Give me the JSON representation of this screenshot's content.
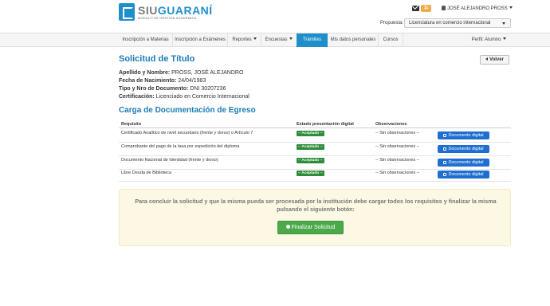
{
  "header": {
    "logo_main": "SIU",
    "logo_accent": "GUARANÍ",
    "logo_sub": "MÓDULO DE GESTIÓN ACADÉMICA",
    "messages_count": "11",
    "user_name": "JOSÉ ALEJANDRO PROSS",
    "propuesta_label": "Propuesta:",
    "propuesta_value": "Licenciatura en comercio internacional"
  },
  "nav": {
    "items": [
      {
        "label": "Inscripción a Materias"
      },
      {
        "label": "Inscripción a Exámenes"
      },
      {
        "label": "Reportes"
      },
      {
        "label": "Encuestas"
      },
      {
        "label": "Trámites"
      },
      {
        "label": "Mis datos personales"
      },
      {
        "label": "Cursos"
      }
    ],
    "profile": "Perfil: Alumno"
  },
  "page": {
    "title": "Solicitud de Título",
    "back_label": "Volver",
    "fields": [
      {
        "label": "Apellido y Nombre:",
        "value": "PROSS, JOSÉ ALEJANDRO"
      },
      {
        "label": "Fecha de Nacimiento:",
        "value": "24/04/1983"
      },
      {
        "label": "Tipo y Nro de Documento:",
        "value": "DNI 30207236"
      },
      {
        "label": "Certificación:",
        "value": "Licenciado en Comercio Internacional"
      }
    ],
    "section_title": "Carga de Documentación de Egreso"
  },
  "table": {
    "headers": [
      "Requisito",
      "Estado presentación digital",
      "Observaciones"
    ],
    "rows": [
      {
        "requisito": "Certificado Analítico de nivel secundario (frente y dorso) o Artículo 7",
        "estado": "-- Aceptado --",
        "obs": "-- Sin observaciones --",
        "action": "Documento digital"
      },
      {
        "requisito": "Comprobante del pago de la tasa por expedición del diploma",
        "estado": "-- Aceptado --",
        "obs": "-- Sin observaciones --",
        "action": "Documento digital"
      },
      {
        "requisito": "Documento Nacional de Identidad (frente y dorso)",
        "estado": "-- Aceptado --",
        "obs": "-- Sin observaciones --",
        "action": "Documento digital"
      },
      {
        "requisito": "Libre Deuda de Biblioteca",
        "estado": "-- Aceptado --",
        "obs": "-- Sin observaciones --",
        "action": "Documento digital"
      }
    ]
  },
  "panel": {
    "message": "Para concluir la solicitud y que la misma pueda ser procesada por la institución debe cargar todos los requisitos y finalizar la misma pulsando el siguiente botón:",
    "button": "Finalizar Solicitud"
  },
  "colors": {
    "brand": "#1f8fcc",
    "accepted": "#2e8b3a",
    "primary_button": "#1f6fd1",
    "success_button": "#4aaa4a",
    "warning_panel": "#fcf8e3"
  }
}
